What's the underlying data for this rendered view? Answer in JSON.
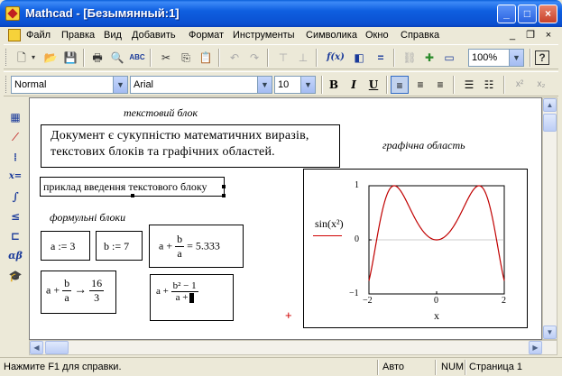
{
  "window": {
    "title": "Mathcad - [Безымянный:1]",
    "controls": {
      "minimize": "_",
      "maximize": "□",
      "close": "×"
    }
  },
  "menu": {
    "items": [
      "Файл",
      "Правка",
      "Вид",
      "Добавить",
      "Формат",
      "Инструменты",
      "Символика",
      "Окно",
      "Справка"
    ],
    "mdi": {
      "minimize": "_",
      "restore": "❐",
      "close": "×"
    }
  },
  "toolbar": {
    "zoom": "100%",
    "fx": "f(x)",
    "help": "?"
  },
  "format_toolbar": {
    "style": "Normal",
    "font": "Arial",
    "size": "10",
    "bold": "B",
    "italic": "I",
    "underline": "U",
    "superscript": "x²",
    "subscript": "x₂"
  },
  "palette": {
    "xeq": "x=",
    "alpha": "αβ"
  },
  "worksheet": {
    "label_text_block": "текстовий блок",
    "doc_text_line1": "Документ є сукупністю математичних виразів,",
    "doc_text_line2": "текстових блоків та графічних областей.",
    "example_text": "приклад введення текстового блоку",
    "label_formula_blocks": "формульні блоки",
    "label_graphic_area": "графічна область",
    "def_a": "a := 3",
    "def_b": "b := 7",
    "expr1": {
      "lhs": "a +",
      "num": "b",
      "den": "a",
      "result": "= 5.333"
    },
    "expr2": {
      "lhs": "a +",
      "num": "b",
      "den": "a",
      "arrow": "→",
      "res_num": "16",
      "res_den": "3"
    },
    "expr3": {
      "lhs": "a +",
      "num": "b² − 1",
      "den": "a +"
    },
    "plot": {
      "func_label": "sin(x²)",
      "x_axis_label": "x",
      "y_ticks": [
        "1",
        "0",
        "−1"
      ],
      "x_ticks": [
        "−2",
        "0",
        "2"
      ]
    },
    "cursor": "+"
  },
  "chart_data": {
    "type": "line",
    "title": "",
    "xlabel": "x",
    "ylabel": "sin(x²)",
    "xlim": [
      -2,
      2
    ],
    "ylim": [
      -1,
      1
    ],
    "series": [
      {
        "name": "sin(x²)",
        "color": "#c00000",
        "expression": "sin(x^2)"
      }
    ]
  },
  "status": {
    "help": "Нажмите F1 для справки.",
    "mode": "Авто",
    "num": "NUM",
    "page": "Страница 1"
  }
}
